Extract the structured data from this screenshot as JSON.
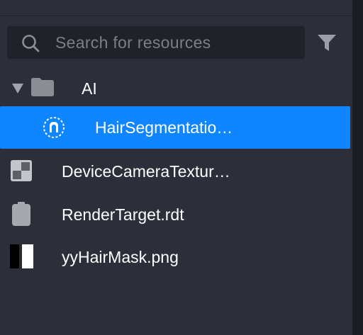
{
  "search": {
    "placeholder": "Search for resources",
    "value": ""
  },
  "tree": {
    "folder": {
      "label": "AI",
      "expanded": true,
      "icon": "folder-icon"
    },
    "items": [
      {
        "label": "HairSegmentatio…",
        "icon": "hair-segmentation-icon",
        "selected": true
      },
      {
        "label": "DeviceCameraTextur…",
        "icon": "texture-checker-icon",
        "selected": false
      },
      {
        "label": "RenderTarget.rdt",
        "icon": "render-target-icon",
        "selected": false
      },
      {
        "label": "yyHairMask.png",
        "icon": "image-mask-icon",
        "selected": false
      }
    ]
  },
  "colors": {
    "panel": "#2c2f39",
    "selection": "#0f86ff",
    "search_bg": "#1f2229"
  }
}
